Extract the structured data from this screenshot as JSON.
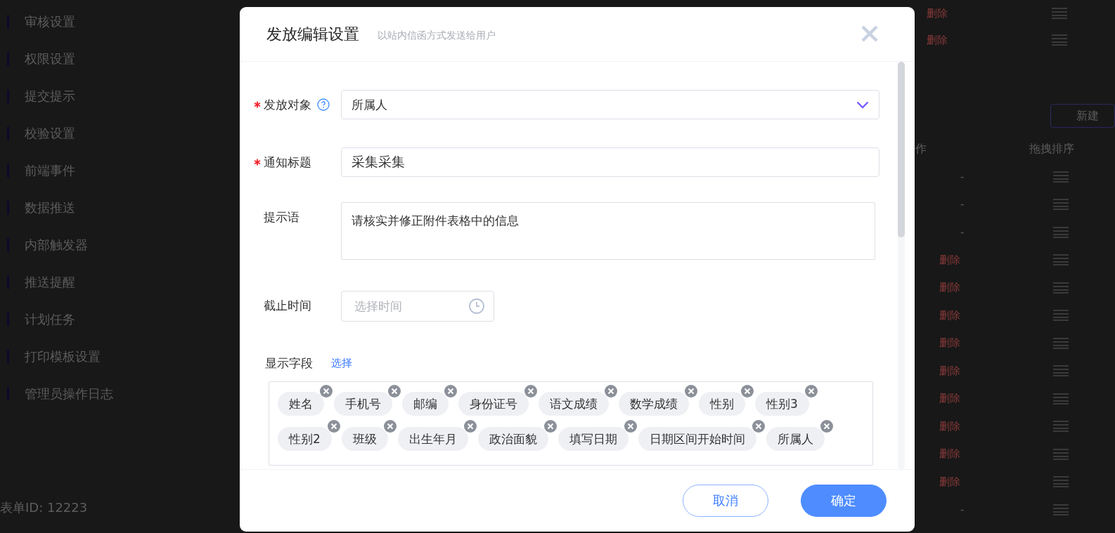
{
  "sidebar": {
    "items": [
      {
        "label": "审核设置"
      },
      {
        "label": "权限设置"
      },
      {
        "label": "提交提示"
      },
      {
        "label": "校验设置"
      },
      {
        "label": "前端事件"
      },
      {
        "label": "数据推送"
      },
      {
        "label": "内部触发器"
      },
      {
        "label": "推送提醒"
      },
      {
        "label": "计划任务"
      },
      {
        "label": "打印模板设置"
      },
      {
        "label": "管理员操作日志"
      }
    ],
    "form_id": "表单ID: 12223"
  },
  "background_table": {
    "top_actions": [
      "删除",
      "删除"
    ],
    "new_button": "新建",
    "columns": [
      "作",
      "拖拽排序"
    ],
    "rows": [
      {
        "action": "-",
        "kind": "plain"
      },
      {
        "action": "-",
        "kind": "plain"
      },
      {
        "action": "-",
        "kind": "plain"
      },
      {
        "action": "删除",
        "kind": "delete"
      },
      {
        "action": "删除",
        "kind": "delete"
      },
      {
        "action": "删除",
        "kind": "delete"
      },
      {
        "action": "删除",
        "kind": "delete"
      },
      {
        "action": "删除",
        "kind": "delete"
      },
      {
        "action": "删除",
        "kind": "delete"
      },
      {
        "action": "删除",
        "kind": "delete"
      },
      {
        "action": "删除",
        "kind": "delete"
      },
      {
        "action": "删除",
        "kind": "delete"
      },
      {
        "action": "-",
        "kind": "plain"
      }
    ]
  },
  "dialog": {
    "title": "发放编辑设置",
    "subtitle": "以站内信函方式发送给用户",
    "fields": [
      {
        "kind": "select",
        "label": "发放对象",
        "required": true,
        "help": true,
        "value": "所属人"
      },
      {
        "kind": "input",
        "label": "通知标题",
        "required": true,
        "value": "采集采集"
      },
      {
        "kind": "textarea",
        "label": "提示语",
        "required": false,
        "value": "请核实并修正附件表格中的信息"
      },
      {
        "kind": "time",
        "label": "截止时间",
        "required": false,
        "placeholder": "选择时间"
      }
    ],
    "display_fields": {
      "label": "显示字段",
      "link": "选择",
      "tag_rows": [
        [
          "姓名",
          "手机号",
          "邮编",
          "身份证号",
          "语文成绩",
          "数学成绩",
          "性别",
          "性别3"
        ],
        [
          "性别2",
          "班级",
          "出生年月",
          "政治面貌",
          "填写日期",
          "日期区间开始时间",
          "所属人"
        ]
      ]
    },
    "buttons": [
      {
        "label": "取消",
        "kind": "secondary"
      },
      {
        "label": "确定",
        "kind": "primary"
      }
    ]
  }
}
